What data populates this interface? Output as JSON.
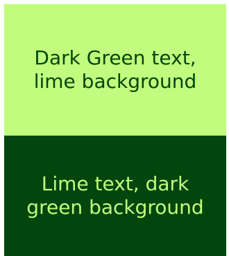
{
  "colors": {
    "lime": "#c2fc7e",
    "dark_green": "#02460e"
  },
  "swatches": [
    {
      "text": "Dark Green text, lime background",
      "text_color": "#02460e",
      "background_color": "#c2fc7e"
    },
    {
      "text": "Lime text, dark green background",
      "text_color": "#c2fc7e",
      "background_color": "#02460e"
    }
  ]
}
